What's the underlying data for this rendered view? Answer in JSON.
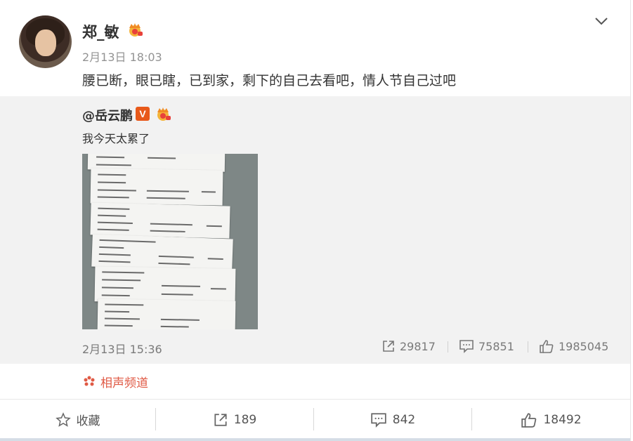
{
  "post": {
    "author": "郑_敏",
    "timestamp": "2月13日 18:03",
    "text": "腰已断，眼已瞎，已到家，剩下的自己去看吧，情人节自己过吧",
    "author_badge_icon": "crown-icon",
    "menu_icon": "chevron-down-icon"
  },
  "repost": {
    "author": "@岳云鹏",
    "verified_mark": "V",
    "text": "我今天太累了",
    "timestamp": "2月13日 15:36",
    "stats": {
      "reposts": "29817",
      "comments": "75851",
      "likes": "1985045"
    }
  },
  "channel": {
    "label": "相声频道",
    "color": "#e05a45"
  },
  "actions": {
    "favorite": "收藏",
    "repost": "189",
    "comment": "842",
    "like": "18492"
  }
}
